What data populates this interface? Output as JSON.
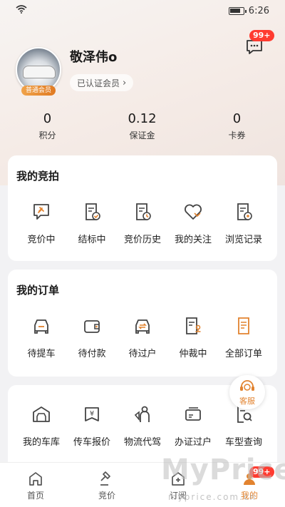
{
  "status_bar": {
    "time": "6:26"
  },
  "header": {
    "message_badge": "99+",
    "username": "敬泽伟o",
    "member_status": "已认证会员",
    "avatar_tag": "普通会员"
  },
  "stats": [
    {
      "value": "0",
      "label": "积分"
    },
    {
      "value": "0.12",
      "label": "保证金"
    },
    {
      "value": "0",
      "label": "卡券"
    }
  ],
  "my_auction": {
    "title": "我的竞拍",
    "items": [
      {
        "label": "竞价中",
        "icon": "hammer-chat-icon"
      },
      {
        "label": "结标中",
        "icon": "document-check-icon"
      },
      {
        "label": "竞价历史",
        "icon": "document-clock-icon"
      },
      {
        "label": "我的关注",
        "icon": "heart-icon"
      },
      {
        "label": "浏览记录",
        "icon": "document-eye-icon"
      }
    ]
  },
  "my_orders": {
    "title": "我的订单",
    "items": [
      {
        "label": "待提车",
        "icon": "car-front-icon"
      },
      {
        "label": "待付款",
        "icon": "wallet-icon"
      },
      {
        "label": "待过户",
        "icon": "car-transfer-icon"
      },
      {
        "label": "仲裁中",
        "icon": "document-stamp-icon"
      },
      {
        "label": "全部订单",
        "icon": "documents-icon"
      }
    ]
  },
  "services": {
    "items": [
      {
        "label": "我的车库",
        "icon": "garage-icon"
      },
      {
        "label": "传车报价",
        "icon": "price-tag-icon"
      },
      {
        "label": "物流代驾",
        "icon": "driver-icon"
      },
      {
        "label": "办证过户",
        "icon": "card-icon"
      },
      {
        "label": "车型查询",
        "icon": "search-document-icon"
      }
    ]
  },
  "customer_service": {
    "label": "客服"
  },
  "tabbar": [
    {
      "label": "首页",
      "icon": "home-icon"
    },
    {
      "label": "竞价",
      "icon": "gavel-icon"
    },
    {
      "label": "订阅",
      "icon": "subscribe-icon"
    },
    {
      "label": "我的",
      "icon": "profile-icon",
      "badge": "99+"
    }
  ],
  "watermark": {
    "text": "MyPrice",
    "sub": "myprice.com.cn"
  },
  "colors": {
    "accent": "#e2832f",
    "badge": "#ff3b30",
    "icon": "#444444"
  }
}
